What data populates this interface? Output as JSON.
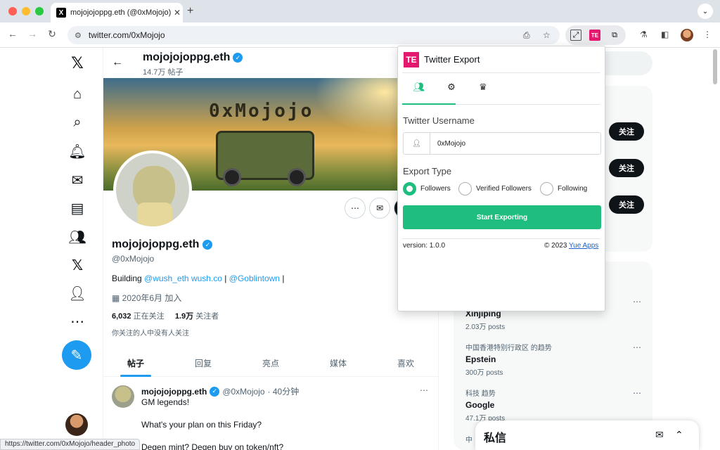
{
  "browser": {
    "tab_title": "mojojojoppg.eth (@0xMojojo) / X",
    "tab_favicon": "X",
    "url": "twitter.com/0xMojojo",
    "status_url": "https://twitter.com/0xMojojo/header_photo"
  },
  "profile": {
    "header_name": "mojojojoppg.eth",
    "header_posts": "14.7万 帖子",
    "banner_text": "0xMojojo",
    "name": "mojojojoppg.eth",
    "handle": "@0xMojojo",
    "bio_prefix": "Building ",
    "bio_link1": "@wush_eth",
    "bio_link2": "wush.co",
    "bio_sep": " | ",
    "bio_link3": "@Goblintown",
    "bio_suffix": " |",
    "joined": "2020年6月 加入",
    "following_count": "6,032",
    "following_label": "正在关注",
    "followers_count": "1.9万",
    "followers_label": "关注者",
    "mutual": "你关注的人中没有人关注"
  },
  "tabs": [
    "帖子",
    "回复",
    "亮点",
    "媒体",
    "喜欢"
  ],
  "tweet": {
    "name": "mojojojoppg.eth",
    "handle": "@0xMojojo",
    "time": "· 40分钟",
    "lines": [
      "GM legends!",
      "What's your plan on this Friday?",
      "Degen mint? Degen buy on token/nft?"
    ]
  },
  "right": {
    "follow_label": "关注",
    "trends": [
      {
        "title": "Xinjiping",
        "count": "2.03万 posts"
      },
      {
        "context": "中国香港特别行政区 的趋势",
        "title": "Epstein",
        "count": "300万 posts"
      },
      {
        "context": "科技 趋势",
        "title": "Google",
        "count": "47.1万 posts"
      },
      {
        "context": "中"
      }
    ],
    "dm_title": "私信"
  },
  "extension": {
    "logo": "TE",
    "title": "Twitter Export",
    "username_label": "Twitter Username",
    "username_value": "0xMojojo",
    "export_type_label": "Export Type",
    "options": [
      "Followers",
      "Verified Followers",
      "Following"
    ],
    "selected": "Followers",
    "start_label": "Start Exporting",
    "version": "version: 1.0.0",
    "copyright": "© 2023",
    "author_link": "Yue Apps",
    "accent": "#1fbe7f",
    "logo_color": "#e5186f"
  },
  "colors": {
    "brand_blue": "#1d9bf0"
  }
}
